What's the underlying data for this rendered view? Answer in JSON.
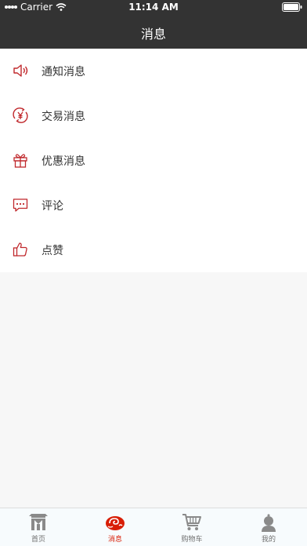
{
  "status_bar": {
    "carrier": "Carrier",
    "time": "11:14 AM"
  },
  "header": {
    "title": "消息"
  },
  "colors": {
    "accent": "#c0282c",
    "nav_bg": "#333333",
    "tab_active": "#d81e06",
    "tab_inactive": "#8a8a8a"
  },
  "menu": {
    "items": [
      {
        "label": "通知消息",
        "icon": "speaker-icon"
      },
      {
        "label": "交易消息",
        "icon": "yen-exchange-icon"
      },
      {
        "label": "优惠消息",
        "icon": "gift-icon"
      },
      {
        "label": "评论",
        "icon": "comment-icon"
      },
      {
        "label": "点赞",
        "icon": "thumbs-up-icon"
      }
    ]
  },
  "tabbar": {
    "items": [
      {
        "label": "首页",
        "icon": "home-icon",
        "active": false
      },
      {
        "label": "消息",
        "icon": "message-icon",
        "active": true
      },
      {
        "label": "购物车",
        "icon": "cart-icon",
        "active": false
      },
      {
        "label": "我的",
        "icon": "user-icon",
        "active": false
      }
    ]
  }
}
